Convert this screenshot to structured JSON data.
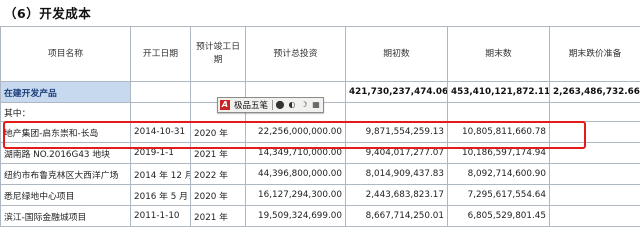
{
  "section_title": "（6）开发成本",
  "headers": [
    "项目名称",
    "开工日期",
    "预计竣工日期",
    "预计总投资",
    "期初数",
    "期末数",
    "期末跌价准备"
  ],
  "subtotal": {
    "label": "在建开发产品",
    "opening": "421,730,237,474.06",
    "closing": "453,410,121,872.11",
    "impairment": "2,263,486,732.66"
  },
  "qizhong_label": "其中：",
  "toolbar": {
    "logo": "A",
    "label": "极品五笔",
    "icons": [
      "full-width-icon",
      "punctuation-icon",
      "moon-icon",
      "keyboard-icon"
    ],
    "glyphs": [
      "⬤",
      "◐",
      "☽",
      "▦"
    ]
  },
  "rows": [
    {
      "name": "地产集团-启东崇和-长岛",
      "start": "2014-10-31",
      "end": "2020 年",
      "invest": "22,256,000,000.00",
      "opening": "9,871,554,259.13",
      "closing": "10,805,811,660.78"
    },
    {
      "name": "湖南路 NO.2016G43 地块",
      "start": "2019-1-1",
      "end": "2021 年",
      "invest": "14,349,710,000.00",
      "opening": "9,404,017,277.07",
      "closing": "10,186,597,174.94"
    },
    {
      "name": "纽约市布鲁克林区大西洋广场",
      "start": "2014 年 12 月",
      "end": "2022 年",
      "invest": "44,396,800,000.00",
      "opening": "8,014,909,437.83",
      "closing": "8,092,714,600.90"
    },
    {
      "name": "悉尼绿地中心项目",
      "start": "2016 年 5 月",
      "end": "2020 年",
      "invest": "16,127,294,300.00",
      "opening": "2,443,683,823.17",
      "closing": "7,295,617,554.64"
    },
    {
      "name": "滨江-国际金融城项目",
      "start": "2011-1-10",
      "end": "2021 年",
      "invest": "19,509,324,699.00",
      "opening": "8,667,714,250.01",
      "closing": "6,805,529,801.45"
    }
  ]
}
